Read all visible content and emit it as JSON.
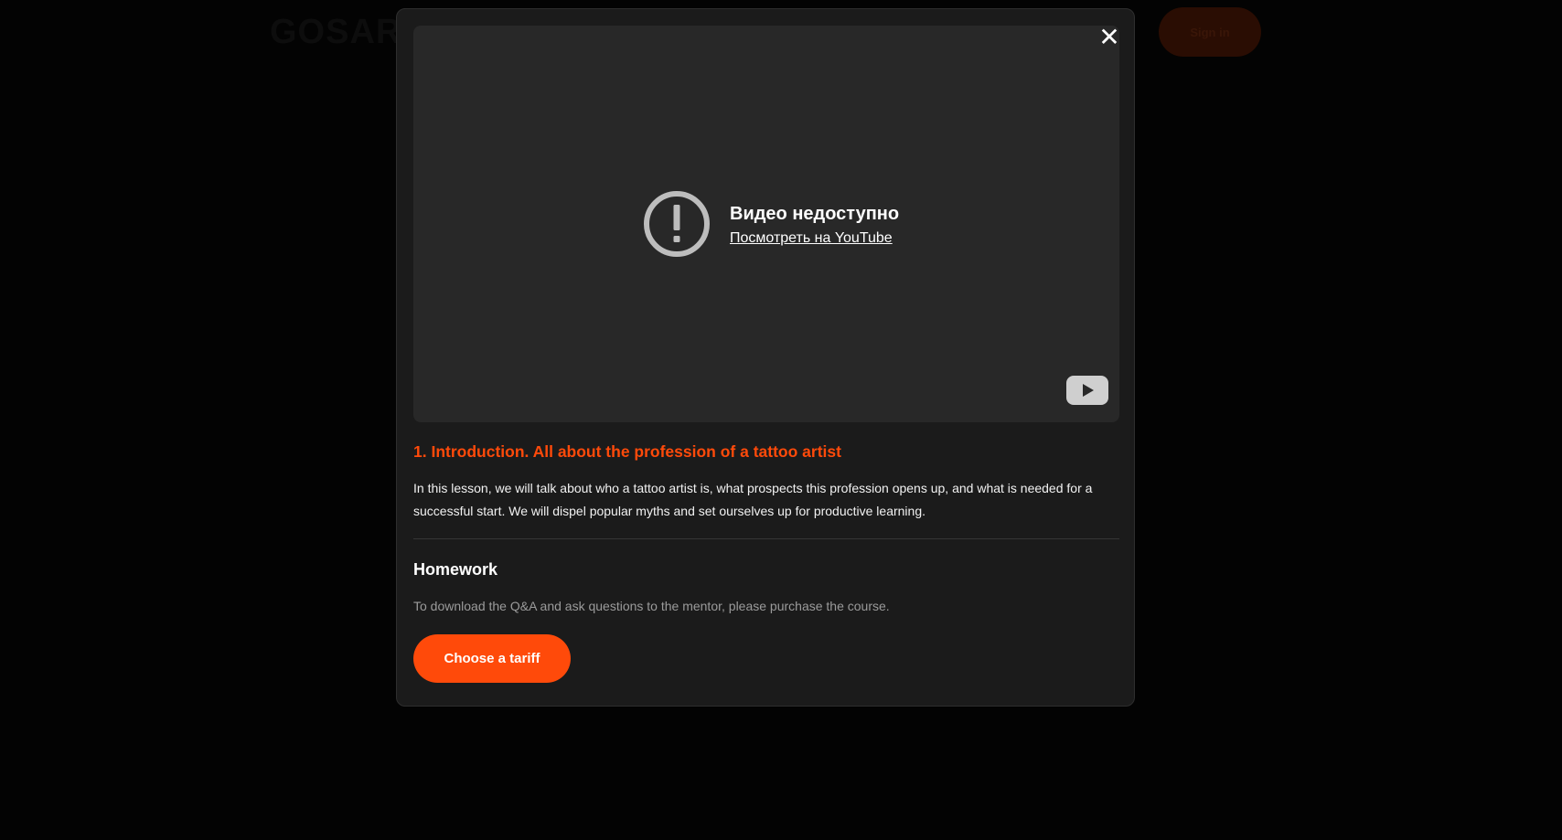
{
  "header": {
    "logo_text": "GOSART",
    "login_label": "Sign in"
  },
  "modal": {
    "close_glyph": "✕",
    "video": {
      "error_title": "Видео недоступно",
      "error_link": "Посмотреть на YouTube",
      "error_icon": "exclamation-circle-icon",
      "platform_icon": "youtube-icon"
    },
    "lesson": {
      "title": "1. Introduction. All about the profession of a tattoo artist",
      "description": "In this lesson, we will talk about who a tattoo artist is, what prospects this profession opens up, and what is needed for a successful start. We will dispel popular myths and set ourselves up for productive learning."
    },
    "homework": {
      "title": "Homework",
      "text": "To download the Q&A and ask questions to the mentor, please purchase the course.",
      "cta_label": "Choose a tariff"
    }
  },
  "colors": {
    "accent": "#ff4a0a",
    "modal_bg": "#1b1b1b",
    "video_bg": "#282828",
    "page_bg": "#030303"
  }
}
